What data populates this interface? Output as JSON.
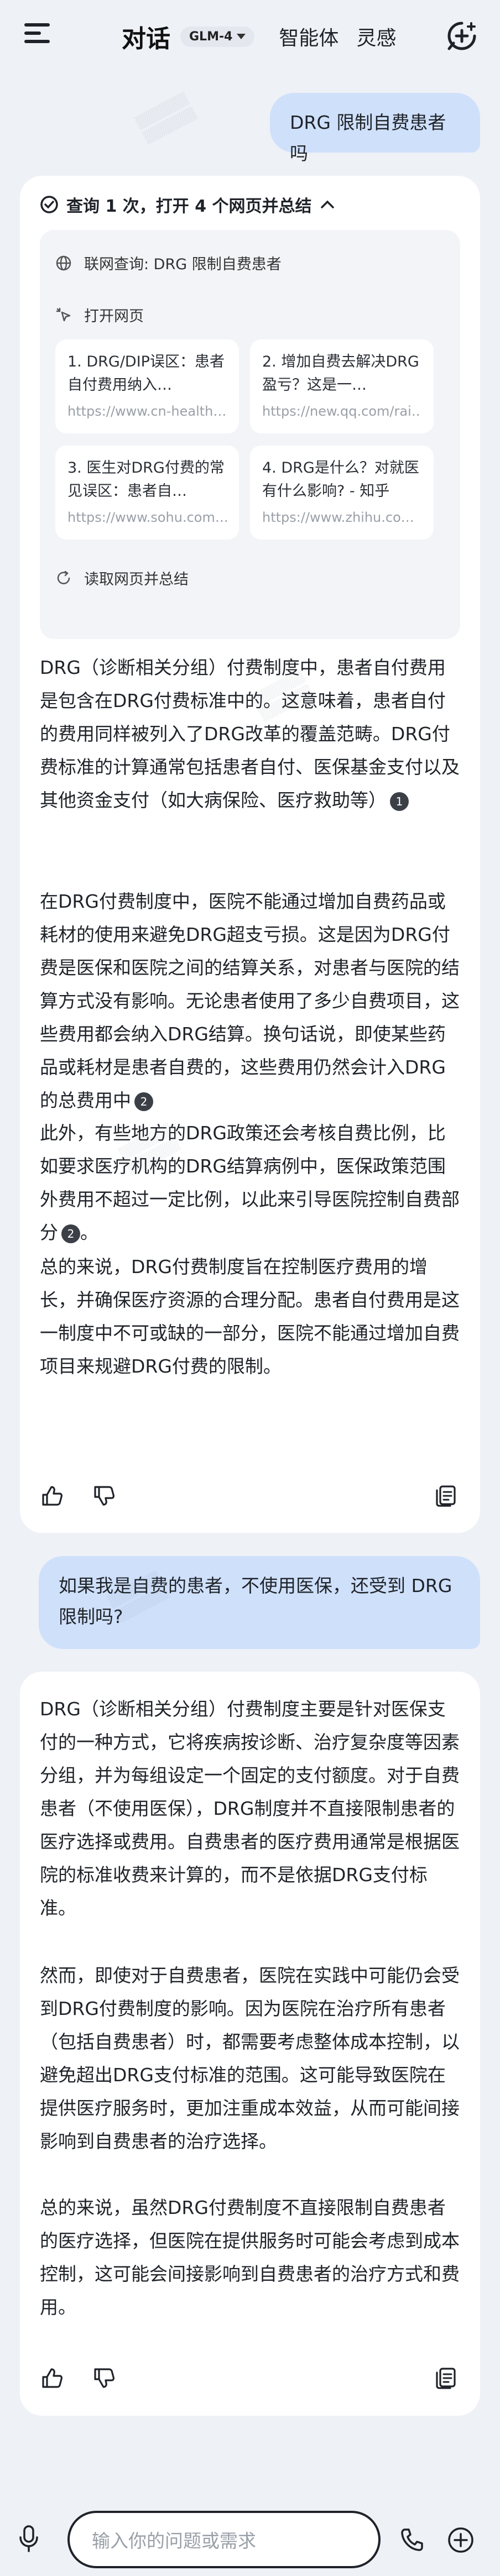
{
  "header": {
    "title": "对话",
    "model": "GLM-4",
    "nav_agents": "智能体",
    "nav_inspiration": "灵感"
  },
  "q1": {
    "text": "DRG 限制自费患者吗"
  },
  "search": {
    "summary": "查询 1 次，打开 4 个网页并总结",
    "query_label": "联网查询: DRG 限制自费患者",
    "open_label": "打开网页",
    "read_label": "读取网页并总结",
    "sources": [
      {
        "title": "1. DRG/DIP误区：患者自付费用纳入…",
        "url": "https://www.cn-health…"
      },
      {
        "title": "2. 增加自费去解决DRG盈亏？这是一…",
        "url": "https://new.qq.com/rai…"
      },
      {
        "title": "3. 医生对DRG付费的常见误区：患者自…",
        "url": "https://www.sohu.com…"
      },
      {
        "title": "4. DRG是什么？对就医有什么影响? - 知乎",
        "url": "https://www.zhihu.co…"
      }
    ]
  },
  "a1": {
    "p1": "DRG（诊断相关分组）付费制度中，患者自付费用是包含在DRG付费标准中的。这意味着，患者自付的费用同样被列入了DRG改革的覆盖范畴。DRG付费标准的计算通常包括患者自付、医保基金支付以及其他资金支付（如大病保险、医疗救助等）",
    "c1": "1",
    "p2": "在DRG付费制度中，医院不能通过增加自费药品或耗材的使用来避免DRG超支亏损。这是因为DRG付费是医保和医院之间的结算关系，对患者与医院的结算方式没有影响。无论患者使用了多少自费项目，这些费用都会纳入DRG结算。换句话说，即使某些药品或耗材是患者自费的，这些费用仍然会计入DRG的总费用中",
    "c2": "2",
    "p3": "此外，有些地方的DRG政策还会考核自费比例，比如要求医疗机构的DRG结算病例中，医保政策范围外费用不超过一定比例，以此来引导医院控制自费部分",
    "c3": "2",
    "p3_end": "。",
    "p4": "总的来说，DRG付费制度旨在控制医疗费用的增长，并确保医疗资源的合理分配。患者自付费用是这一制度中不可或缺的一部分，医院不能通过增加自费项目来规避DRG付费的限制。"
  },
  "q2": {
    "text": "如果我是自费的患者，不使用医保，还受到 DRG 限制吗?"
  },
  "a2": {
    "p1": "DRG（诊断相关分组）付费制度主要是针对医保支付的一种方式，它将疾病按诊断、治疗复杂度等因素分组，并为每组设定一个固定的支付额度。对于自费患者（不使用医保），DRG制度并不直接限制患者的医疗选择或费用。自费患者的医疗费用通常是根据医院的标准收费来计算的，而不是依据DRG支付标准。",
    "p2": "然而，即使对于自费患者，医院在实践中可能仍会受到DRG付费制度的影响。因为医院在治疗所有患者（包括自费患者）时，都需要考虑整体成本控制，以避免超出DRG支付标准的范围。这可能导致医院在提供医疗服务时，更加注重成本效益，从而可能间接影响到自费患者的治疗选择。",
    "p3": "总的来说，虽然DRG付费制度不直接限制自费患者的医疗选择，但医院在提供服务时可能会考虑到成本控制，这可能会间接影响到自费患者的治疗方式和费用。"
  },
  "input": {
    "placeholder": "输入你的问题或需求"
  },
  "colors": {
    "bubble": "#cfe0fb",
    "background": "#eef1f6",
    "card": "#ffffff"
  }
}
